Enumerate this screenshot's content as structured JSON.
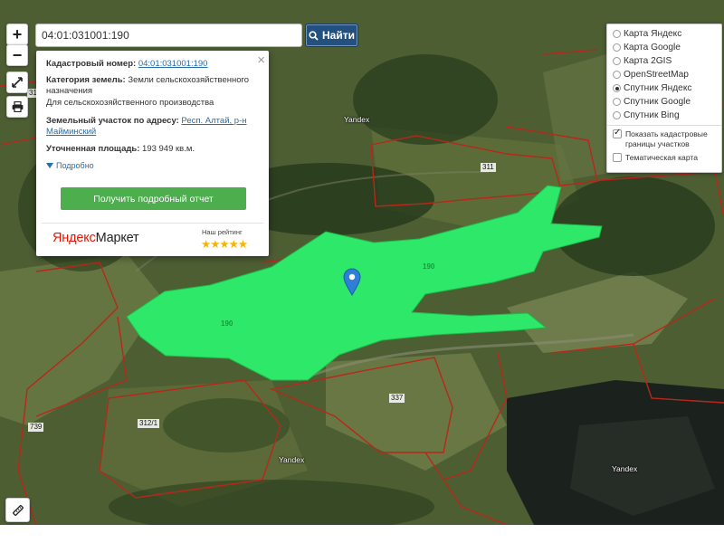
{
  "search": {
    "query": "04:01:031001:190",
    "button_label": "Найти"
  },
  "controls": {
    "zoom_in": "+",
    "zoom_out": "−"
  },
  "info_card": {
    "close": "×",
    "cadastral_label": "Кадастровый номер:",
    "cadastral_value": "04:01:031001:190",
    "category_label": "Категория земель:",
    "category_value": "Земли сельскохозяйственного назначения",
    "usage_value": "Для сельскохозяйственного производства",
    "address_label": "Земельный участок по адресу:",
    "address_value": "Респ. Алтай, р-н Майминский",
    "area_label": "Уточненная площадь:",
    "area_value": "193 949 кв.м.",
    "details_link": "Подробно",
    "report_button": "Получить подробный отчет",
    "market_logo_part1": "Яндекс",
    "market_logo_part2": "Маркет",
    "rating_label": "Наш рейтинг",
    "rating_stars": "★★★★★",
    "rating_value": 5
  },
  "layers": {
    "options": [
      {
        "label": "Карта Яндекс",
        "selected": false
      },
      {
        "label": "Карта Google",
        "selected": false
      },
      {
        "label": "Карта 2GIS",
        "selected": false
      },
      {
        "label": "OpenStreetMap",
        "selected": false
      },
      {
        "label": "Спутник Яндекс",
        "selected": true
      },
      {
        "label": "Спутник Google",
        "selected": false
      },
      {
        "label": "Спутник Bing",
        "selected": false
      }
    ],
    "show_cadastral": {
      "label": "Показать кадастровые границы участков",
      "checked": true
    },
    "thematic": {
      "label": "Тематическая карта",
      "checked": false
    }
  },
  "map": {
    "watermarks": [
      "Yandex",
      "Yandex",
      "Yandex"
    ],
    "parcel_labels": [
      "311",
      "190",
      "190",
      "337",
      "312/1",
      "739",
      "312"
    ],
    "highlight_color": "#2ee86a",
    "boundary_color": "#b7281b",
    "marker_color": "#2f7fd6"
  }
}
